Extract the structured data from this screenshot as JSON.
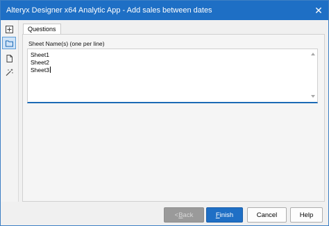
{
  "window": {
    "title": "Alteryx Designer x64 Analytic App - Add sales between dates",
    "close_glyph": "✕"
  },
  "sidebar": {
    "items": [
      {
        "icon": "app-icon",
        "active": false
      },
      {
        "icon": "folder-icon",
        "active": true
      },
      {
        "icon": "document-icon",
        "active": false
      },
      {
        "icon": "wand-icon",
        "active": false
      }
    ]
  },
  "tabs": [
    {
      "label": "Questions",
      "active": true
    }
  ],
  "question": {
    "label": "Sheet Name(s) (one per line)",
    "lines": [
      "Sheet1",
      "Sheet2",
      "Sheet3"
    ]
  },
  "footer": {
    "back_prefix": "< ",
    "back_mnemonic": "B",
    "back_rest": "ack",
    "finish_mnemonic": "F",
    "finish_rest": "inish",
    "cancel_label": "Cancel",
    "help_label": "Help"
  },
  "colors": {
    "titlebar": "#1e6fc5",
    "finish_button": "#1f6fc5",
    "active_sidebar": "#cfe3f7",
    "textarea_underline": "#1b6ab5"
  }
}
